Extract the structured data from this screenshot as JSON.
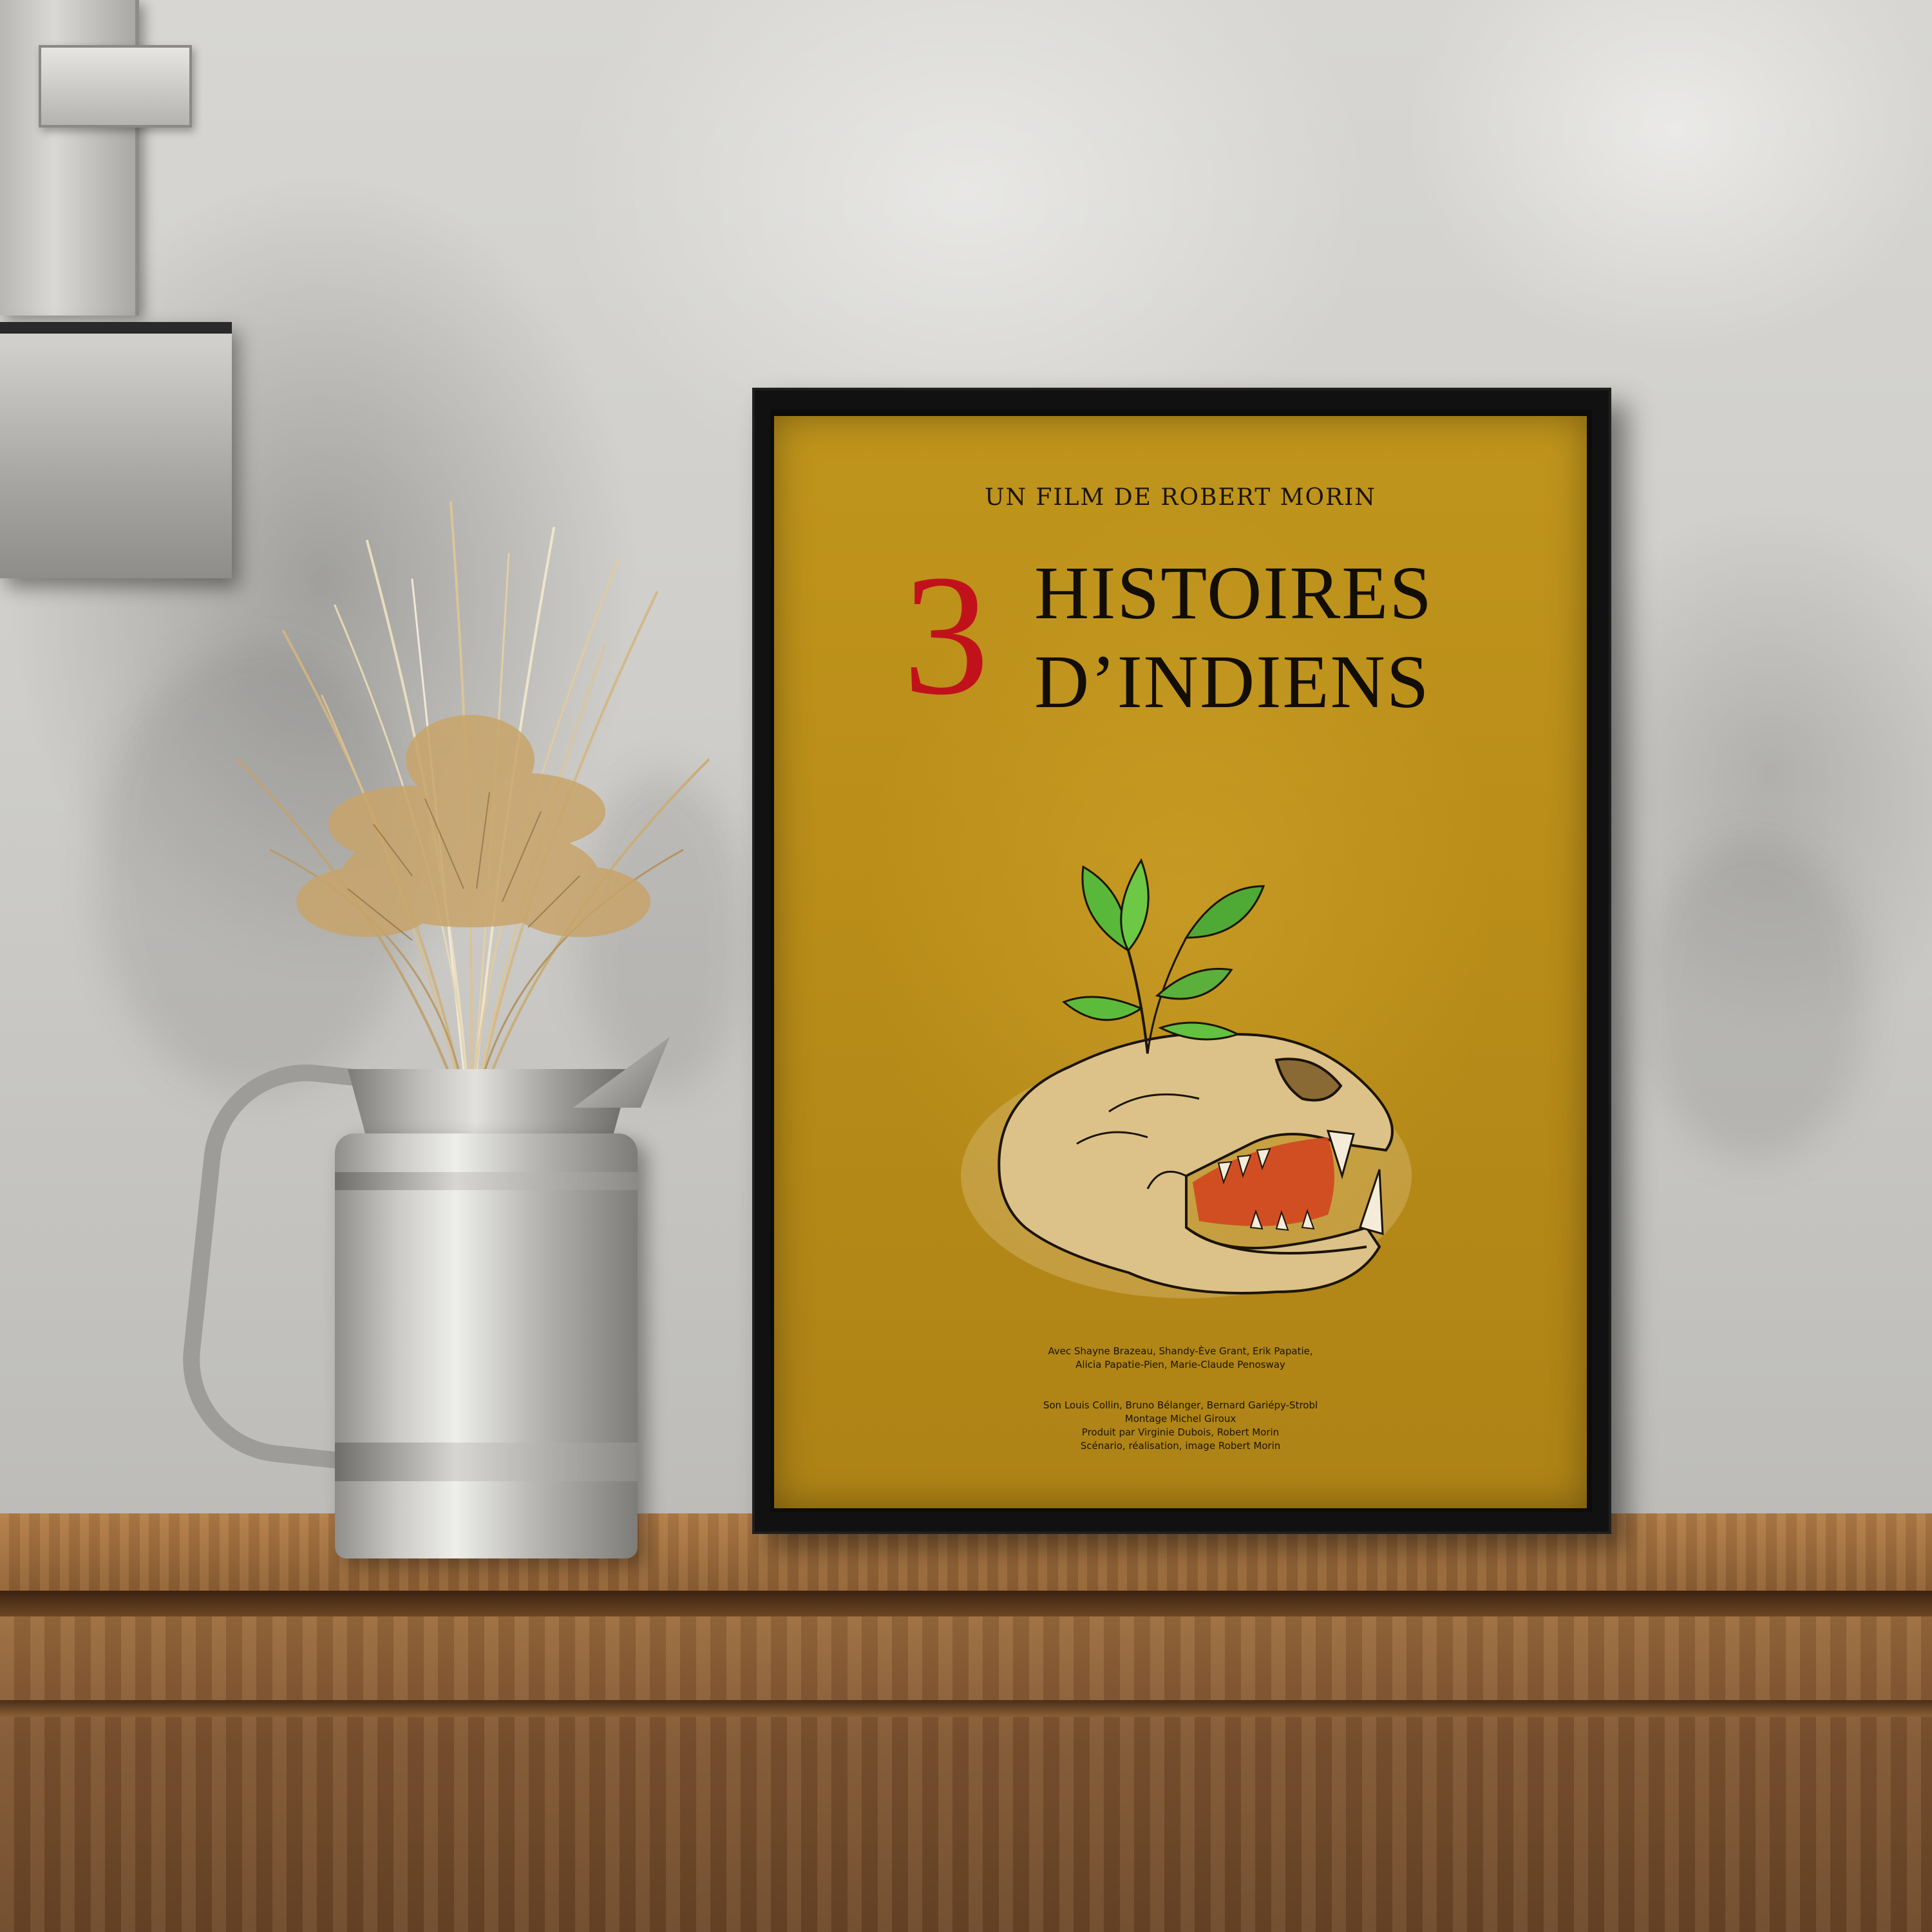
{
  "poster": {
    "subtitle": "UN FILM DE ROBERT MORIN",
    "title_number": "3",
    "title_line1": "HISTOIRES",
    "title_line2": "D’INDIENS",
    "cast_lines": [
      "Avec Shayne Brazeau, Shandy-Ève Grant, Erik Papatie,",
      "Alicia Papatie-Pien, Marie-Claude Penosway"
    ],
    "crew_lines": [
      "Son Louis Collin, Bruno Bélanger, Bernard Gariépy-Strobl",
      "Montage Michel Giroux",
      "Produit par Virginie Dubois, Robert Morin",
      "Scénario, réalisation, image Robert Morin"
    ],
    "colors": {
      "background": "#b88c18",
      "number_red": "#c1121c",
      "text": "#120d05"
    }
  }
}
